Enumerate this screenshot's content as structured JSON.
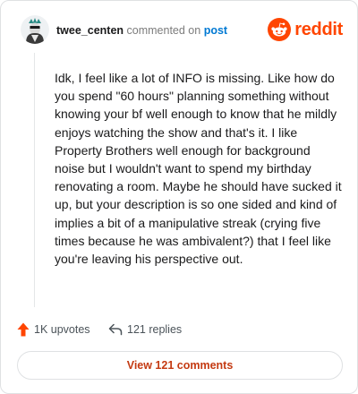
{
  "comment": {
    "username": "twee_centen",
    "action_text": "commented on",
    "post_link_text": "post",
    "body": "Idk, I feel like a lot of INFO is missing. Like how do you spend \"60 hours\" planning something without knowing your bf well enough to know that he mildly enjoys watching the show and that's it. I like Property Brothers well enough for background noise but I wouldn't want to spend my birthday renovating a room. Maybe he should have sucked it up, but your description is so one sided and kind of implies a bit of a manipulative streak (crying five times because he was ambivalent?) that I feel like you're leaving his perspective out."
  },
  "brand": {
    "wordmark": "reddit",
    "color": "#ff4500",
    "icon": "reddit-snoo-icon"
  },
  "stats": {
    "upvotes_label": "1K upvotes",
    "replies_label": "121 replies",
    "upvote_icon": "upvote-arrow-icon",
    "reply_icon": "reply-arrow-icon",
    "upvote_color": "#ff4500"
  },
  "view_comments": {
    "label": "View 121 comments",
    "color": "#c43a12"
  }
}
